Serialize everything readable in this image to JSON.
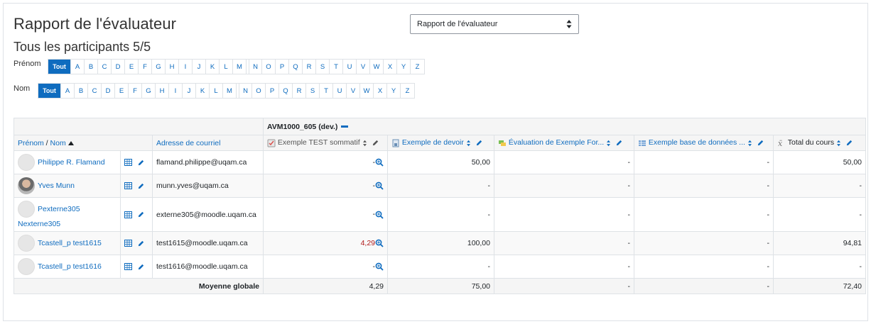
{
  "page": {
    "title": "Rapport de l'évaluateur",
    "subtitle": "Tous les participants 5/5"
  },
  "report_select": {
    "value": "Rapport de l'évaluateur"
  },
  "firstname_filter": {
    "label": "Prénom",
    "all_label": "Tout",
    "letters": [
      "A",
      "B",
      "C",
      "D",
      "E",
      "F",
      "G",
      "H",
      "I",
      "J",
      "K",
      "L",
      "M",
      "N",
      "O",
      "P",
      "Q",
      "R",
      "S",
      "T",
      "U",
      "V",
      "W",
      "X",
      "Y",
      "Z"
    ]
  },
  "lastname_filter": {
    "label": "Nom",
    "all_label": "Tout",
    "letters": [
      "A",
      "B",
      "C",
      "D",
      "E",
      "F",
      "G",
      "H",
      "I",
      "J",
      "K",
      "L",
      "M",
      "N",
      "O",
      "P",
      "Q",
      "R",
      "S",
      "T",
      "U",
      "V",
      "W",
      "X",
      "Y",
      "Z"
    ]
  },
  "table": {
    "category": "AVM1000_605 (dev.)",
    "headers": {
      "name_first": "Prénom",
      "name_sep": " / ",
      "name_last": "Nom",
      "email": "Adresse de courriel",
      "items": [
        "Exemple TEST sommatif",
        "Exemple de devoir",
        "Évaluation de Exemple For...",
        "Exemple base de données ...",
        "Total du cours"
      ]
    },
    "rows": [
      {
        "name": "Philippe R. Flamand",
        "name2": "",
        "email": "flamand.philippe@uqam.ca",
        "test": "-",
        "devoir": "50,00",
        "eval": "-",
        "bdd": "-",
        "total": "50,00",
        "avatar": "default"
      },
      {
        "name": "Yves Munn",
        "name2": "",
        "email": "munn.yves@uqam.ca",
        "test": "-",
        "devoir": "-",
        "eval": "-",
        "bdd": "-",
        "total": "-",
        "avatar": "photo"
      },
      {
        "name": "Pexterne305",
        "name2": "Nexterne305",
        "email": "externe305@moodle.uqam.ca",
        "test": "-",
        "devoir": "-",
        "eval": "-",
        "bdd": "-",
        "total": "-",
        "avatar": "default"
      },
      {
        "name": "Tcastell_p test1615",
        "name2": "",
        "email": "test1615@moodle.uqam.ca",
        "test": "4,29",
        "devoir": "100,00",
        "eval": "-",
        "bdd": "-",
        "total": "94,81",
        "avatar": "default"
      },
      {
        "name": "Tcastell_p test1616",
        "name2": "",
        "email": "test1616@moodle.uqam.ca",
        "test": "-",
        "devoir": "-",
        "eval": "-",
        "bdd": "-",
        "total": "-",
        "avatar": "default"
      }
    ],
    "average": {
      "label": "Moyenne globale",
      "test": "4,29",
      "devoir": "75,00",
      "eval": "-",
      "bdd": "-",
      "total": "72,40"
    }
  },
  "colors": {
    "link": "#0f6cbf",
    "border": "#dee2e6",
    "header_bg": "#f5f5f5",
    "grade_red": "#b01a1a"
  }
}
